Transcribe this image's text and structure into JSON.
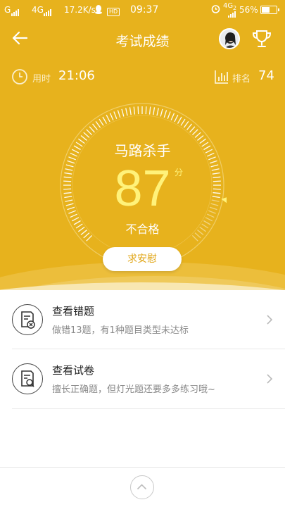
{
  "status_bar": {
    "left_net": "G",
    "net_type": "4G",
    "speed": "17.2K/s",
    "sim": "HD",
    "time": "09:37",
    "right_net": "4G",
    "right_net_sub": "2",
    "battery": "56%",
    "battery_level": 0.56
  },
  "nav": {
    "title": "考试成绩",
    "back_icon": "back-arrow-icon",
    "trophy_icon": "trophy-icon"
  },
  "stats": {
    "time_label": "用时",
    "time_value": "21:06",
    "rank_label": "排名",
    "rank_value": "74"
  },
  "result": {
    "title": "马路杀手",
    "score": "87",
    "score_unit": "分",
    "max_score": 100,
    "status": "不合格",
    "comfort_button": "求安慰"
  },
  "list": [
    {
      "title": "查看错题",
      "desc": "做错13题，有1种题目类型未达标",
      "icon": "wrong-doc-icon"
    },
    {
      "title": "查看试卷",
      "desc": "擅长正确题，但灯光题还要多多练习哦~",
      "icon": "search-doc-icon"
    }
  ],
  "colors": {
    "brand": "#E7B21D",
    "score": "#FFF27A"
  }
}
